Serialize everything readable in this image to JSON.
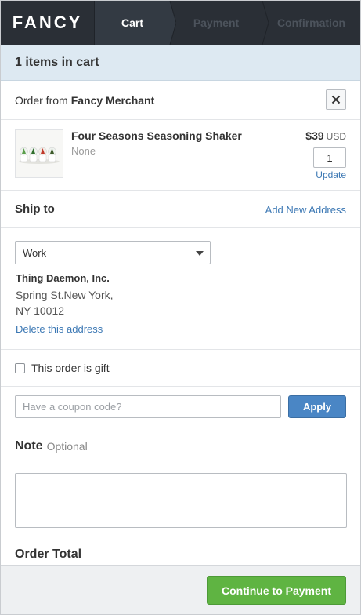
{
  "header": {
    "logo": "FANCY",
    "steps": [
      {
        "label": "Cart",
        "active": true
      },
      {
        "label": "Payment",
        "active": false
      },
      {
        "label": "Confirmation",
        "active": false
      }
    ]
  },
  "cart": {
    "items_summary": "1 items in cart",
    "order_from_prefix": "Order from",
    "merchant": "Fancy Merchant",
    "close_icon": "close-icon"
  },
  "product": {
    "name": "Four Seasons Seasoning Shaker",
    "option": "None",
    "price": "$39",
    "currency": "USD",
    "quantity": "1",
    "update_label": "Update"
  },
  "shipping": {
    "title": "Ship to",
    "add_address_label": "Add New Address",
    "selected_address": "Work",
    "name": "Thing Daemon, Inc.",
    "line1": "Spring St.New York,",
    "line2": "NY 10012",
    "delete_label": "Delete this address"
  },
  "gift": {
    "label": "This order is gift",
    "checked": false
  },
  "coupon": {
    "placeholder": "Have a coupon code?",
    "apply_label": "Apply"
  },
  "note": {
    "title": "Note",
    "optional_label": "Optional"
  },
  "order_total": {
    "title": "Order Total"
  },
  "footer": {
    "continue_label": "Continue to Payment"
  },
  "colors": {
    "nav_bg": "#2a2f36",
    "items_bar_bg": "#dde9f2",
    "link": "#3c78b4",
    "apply_button": "#4a86c5",
    "continue_button": "#5fb442"
  }
}
